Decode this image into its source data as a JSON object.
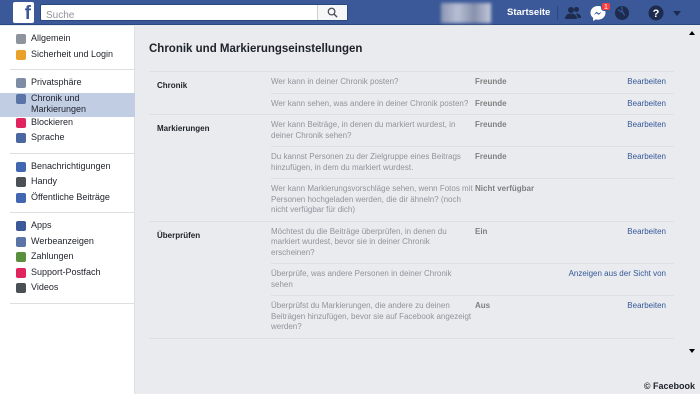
{
  "header": {
    "logo": "f",
    "search_placeholder": "Suche",
    "home_label": "Startseite",
    "notification_count": "1",
    "icons": [
      "search-icon",
      "friends-icon",
      "messages-icon",
      "globe-icon",
      "help-icon",
      "chevron-down-icon"
    ]
  },
  "sidebar": {
    "groups": [
      [
        {
          "label": "Allgemein",
          "icon": "gear-icon",
          "color": "#8d949e"
        },
        {
          "label": "Sicherheit und Login",
          "icon": "shield-icon",
          "color": "#e9a12a"
        }
      ],
      [
        {
          "label": "Privatsphäre",
          "icon": "lock-icon",
          "color": "#7f8ca6"
        },
        {
          "label": "Chronik und Markierungen",
          "icon": "timeline-icon",
          "color": "#5b74a8",
          "active": true
        },
        {
          "label": "Blockieren",
          "icon": "block-icon",
          "color": "#e0245e"
        },
        {
          "label": "Sprache",
          "icon": "language-icon",
          "color": "#4b67a1"
        }
      ],
      [
        {
          "label": "Benachrichtigungen",
          "icon": "globe-icon",
          "color": "#4267b2"
        },
        {
          "label": "Handy",
          "icon": "phone-icon",
          "color": "#4b4f56"
        },
        {
          "label": "Öffentliche Beiträge",
          "icon": "rss-icon",
          "color": "#4267b2"
        }
      ],
      [
        {
          "label": "Apps",
          "icon": "apps-icon",
          "color": "#3b5998"
        },
        {
          "label": "Werbeanzeigen",
          "icon": "ads-icon",
          "color": "#5b74a8"
        },
        {
          "label": "Zahlungen",
          "icon": "payments-icon",
          "color": "#5a8f3d"
        },
        {
          "label": "Support-Postfach",
          "icon": "lifebuoy-icon",
          "color": "#e0245e"
        },
        {
          "label": "Videos",
          "icon": "video-icon",
          "color": "#4b4f56"
        }
      ]
    ]
  },
  "main": {
    "title": "Chronik und Markierungseinstellungen",
    "sections": [
      {
        "title": "Chronik",
        "rows": [
          {
            "q": "Wer kann in deiner Chronik posten?",
            "v": "Freunde",
            "a": "Bearbeiten"
          },
          {
            "q": "Wer kann sehen, was andere in deiner Chronik posten?",
            "v": "Freunde",
            "a": "Bearbeiten"
          }
        ]
      },
      {
        "title": "Markierungen",
        "rows": [
          {
            "q": "Wer kann Beiträge, in denen du markiert wurdest, in deiner Chronik sehen?",
            "v": "Freunde",
            "a": "Bearbeiten"
          },
          {
            "q": "Du kannst Personen zu der Zielgruppe eines Beitrags hinzufügen, in dem du markiert wurdest.",
            "v": "Freunde",
            "a": "Bearbeiten"
          },
          {
            "q": "Wer kann Markierungsvorschläge sehen, wenn Fotos mit Personen hochgeladen werden, die dir ähneln? (noch nicht verfügbar für dich)",
            "v": "Nicht verfügbar",
            "a": ""
          }
        ]
      },
      {
        "title": "Überprüfen",
        "rows": [
          {
            "q": "Möchtest du die Beiträge überprüfen, in denen du markiert wurdest, bevor sie in deiner Chronik erscheinen?",
            "v": "Ein",
            "a": "Bearbeiten"
          },
          {
            "q": "Überprüfe, was andere Personen in deiner Chronik sehen",
            "v": "",
            "a": "Anzeigen aus der Sicht von"
          },
          {
            "q": "Überprüfst du Markierungen, die andere zu deinen Beiträgen hinzufügen, bevor sie auf Facebook angezeigt werden?",
            "v": "Aus",
            "a": "Bearbeiten"
          }
        ]
      }
    ]
  },
  "credit": "© Facebook",
  "colors": {
    "brand": "#3b5998",
    "link": "#365899",
    "active_bg": "#c1cde3"
  }
}
